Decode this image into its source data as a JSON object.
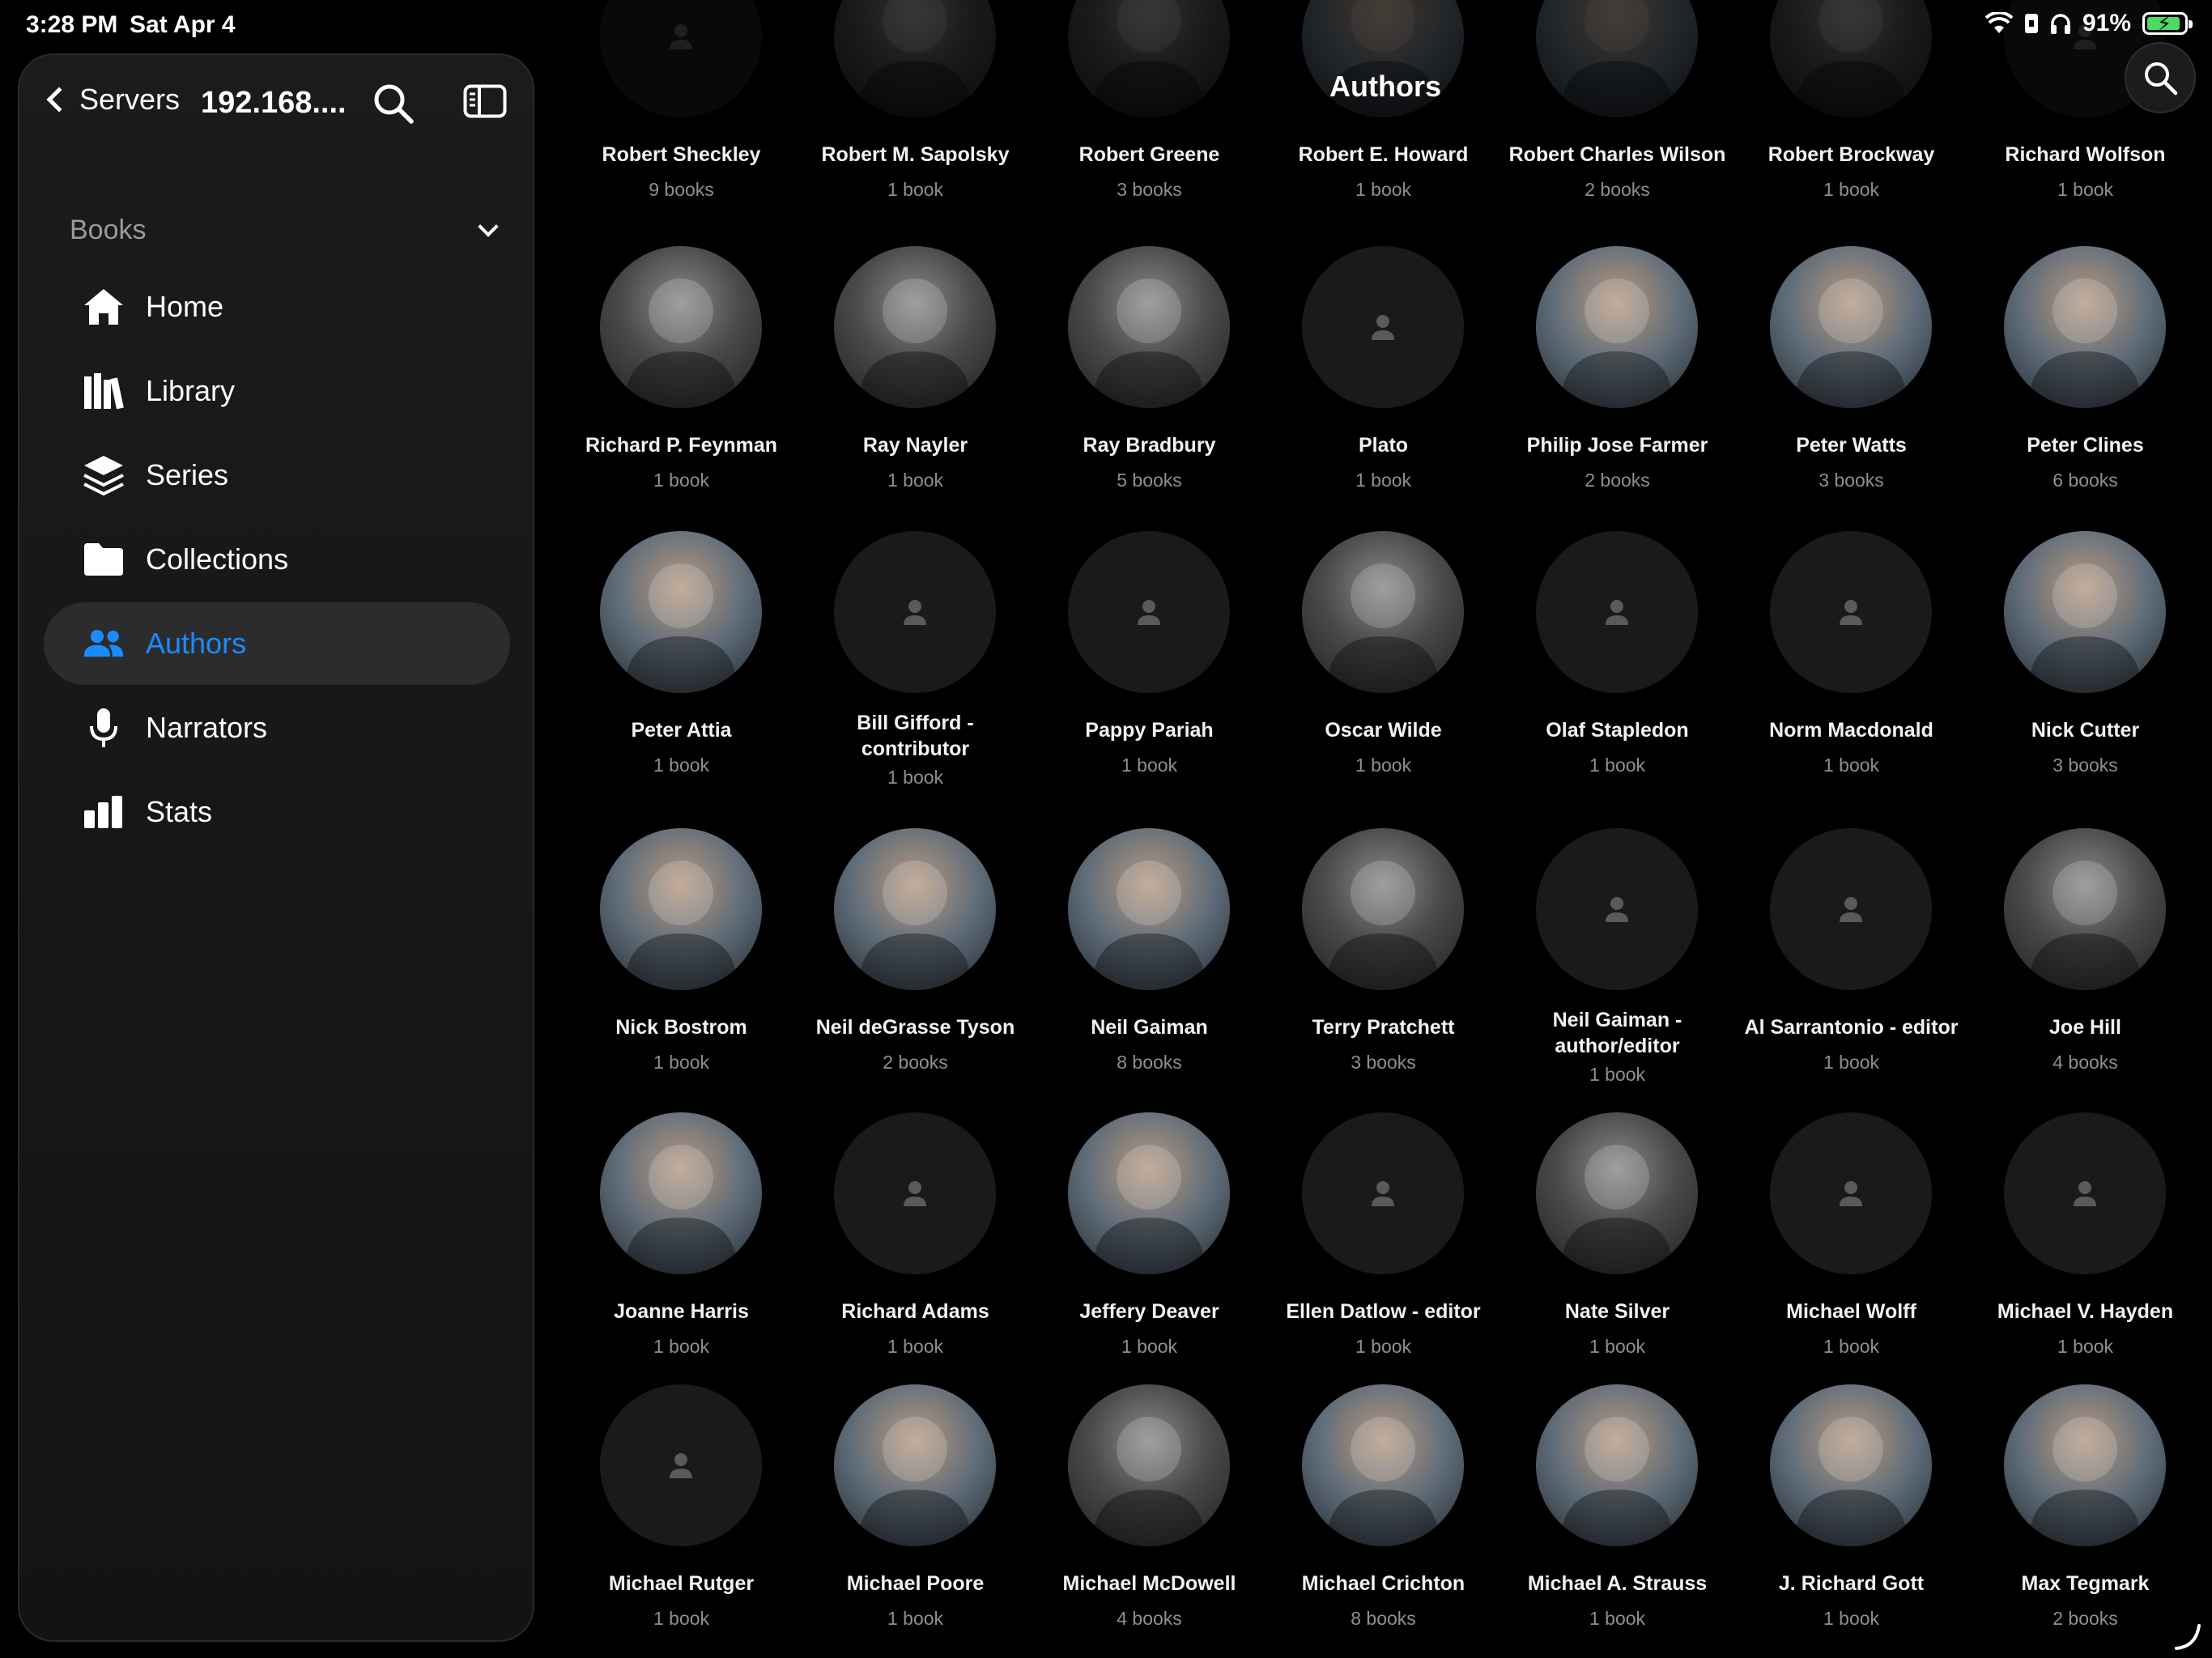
{
  "status": {
    "time": "3:28 PM",
    "date": "Sat Apr 4",
    "battery": "91%",
    "battery_level": 0.91
  },
  "sidebar": {
    "back_label": "Servers",
    "server_name": "192.168....",
    "section_label": "Books",
    "items": [
      {
        "label": "Home",
        "icon": "home-icon"
      },
      {
        "label": "Library",
        "icon": "library-icon"
      },
      {
        "label": "Series",
        "icon": "layers-icon"
      },
      {
        "label": "Collections",
        "icon": "folder-icon"
      },
      {
        "label": "Authors",
        "icon": "people-icon",
        "active": true
      },
      {
        "label": "Narrators",
        "icon": "microphone-icon"
      },
      {
        "label": "Stats",
        "icon": "bar-chart-icon"
      }
    ]
  },
  "header": {
    "title": "Authors"
  },
  "authors": [
    {
      "name": "Robert Sheckley",
      "count": "9 books",
      "photo": "none"
    },
    {
      "name": "Robert M. Sapolsky",
      "count": "1 book",
      "photo": "gray"
    },
    {
      "name": "Robert Greene",
      "count": "3 books",
      "photo": "gray"
    },
    {
      "name": "Robert E. Howard",
      "count": "1 book",
      "photo": "color"
    },
    {
      "name": "Robert Charles Wilson",
      "count": "2 books",
      "photo": "color"
    },
    {
      "name": "Robert Brockway",
      "count": "1 book",
      "photo": "gray"
    },
    {
      "name": "Richard Wolfson",
      "count": "1 book",
      "photo": "none"
    },
    {
      "name": "Richard P. Feynman",
      "count": "1 book",
      "photo": "gray"
    },
    {
      "name": "Ray Nayler",
      "count": "1 book",
      "photo": "gray"
    },
    {
      "name": "Ray Bradbury",
      "count": "5 books",
      "photo": "gray"
    },
    {
      "name": "Plato",
      "count": "1 book",
      "photo": "none"
    },
    {
      "name": "Philip Jose Farmer",
      "count": "2 books",
      "photo": "color"
    },
    {
      "name": "Peter Watts",
      "count": "3 books",
      "photo": "color"
    },
    {
      "name": "Peter Clines",
      "count": "6 books",
      "photo": "color"
    },
    {
      "name": "Peter Attia",
      "count": "1 book",
      "photo": "color"
    },
    {
      "name": "Bill Gifford - contributor",
      "count": "1 book",
      "photo": "none"
    },
    {
      "name": "Pappy Pariah",
      "count": "1 book",
      "photo": "none"
    },
    {
      "name": "Oscar Wilde",
      "count": "1 book",
      "photo": "gray"
    },
    {
      "name": "Olaf Stapledon",
      "count": "1 book",
      "photo": "none"
    },
    {
      "name": "Norm Macdonald",
      "count": "1 book",
      "photo": "none"
    },
    {
      "name": "Nick Cutter",
      "count": "3 books",
      "photo": "color"
    },
    {
      "name": "Nick Bostrom",
      "count": "1 book",
      "photo": "color"
    },
    {
      "name": "Neil deGrasse Tyson",
      "count": "2 books",
      "photo": "color"
    },
    {
      "name": "Neil Gaiman",
      "count": "8 books",
      "photo": "color"
    },
    {
      "name": "Terry Pratchett",
      "count": "3 books",
      "photo": "gray"
    },
    {
      "name": "Neil Gaiman - author/editor",
      "count": "1 book",
      "photo": "none"
    },
    {
      "name": "Al Sarrantonio - editor",
      "count": "1 book",
      "photo": "none"
    },
    {
      "name": "Joe Hill",
      "count": "4 books",
      "photo": "gray"
    },
    {
      "name": "Joanne Harris",
      "count": "1 book",
      "photo": "color"
    },
    {
      "name": "Richard Adams",
      "count": "1 book",
      "photo": "none"
    },
    {
      "name": "Jeffery Deaver",
      "count": "1 book",
      "photo": "color"
    },
    {
      "name": "Ellen Datlow - editor",
      "count": "1 book",
      "photo": "none"
    },
    {
      "name": "Nate Silver",
      "count": "1 book",
      "photo": "gray"
    },
    {
      "name": "Michael Wolff",
      "count": "1 book",
      "photo": "none"
    },
    {
      "name": "Michael V. Hayden",
      "count": "1 book",
      "photo": "none"
    },
    {
      "name": "Michael Rutger",
      "count": "1 book",
      "photo": "none"
    },
    {
      "name": "Michael Poore",
      "count": "1 book",
      "photo": "color"
    },
    {
      "name": "Michael McDowell",
      "count": "4 books",
      "photo": "gray"
    },
    {
      "name": "Michael Crichton",
      "count": "8 books",
      "photo": "color"
    },
    {
      "name": "Michael A. Strauss",
      "count": "1 book",
      "photo": "color"
    },
    {
      "name": "J. Richard Gott",
      "count": "1 book",
      "photo": "color"
    },
    {
      "name": "Max Tegmark",
      "count": "2 books",
      "photo": "color"
    }
  ]
}
